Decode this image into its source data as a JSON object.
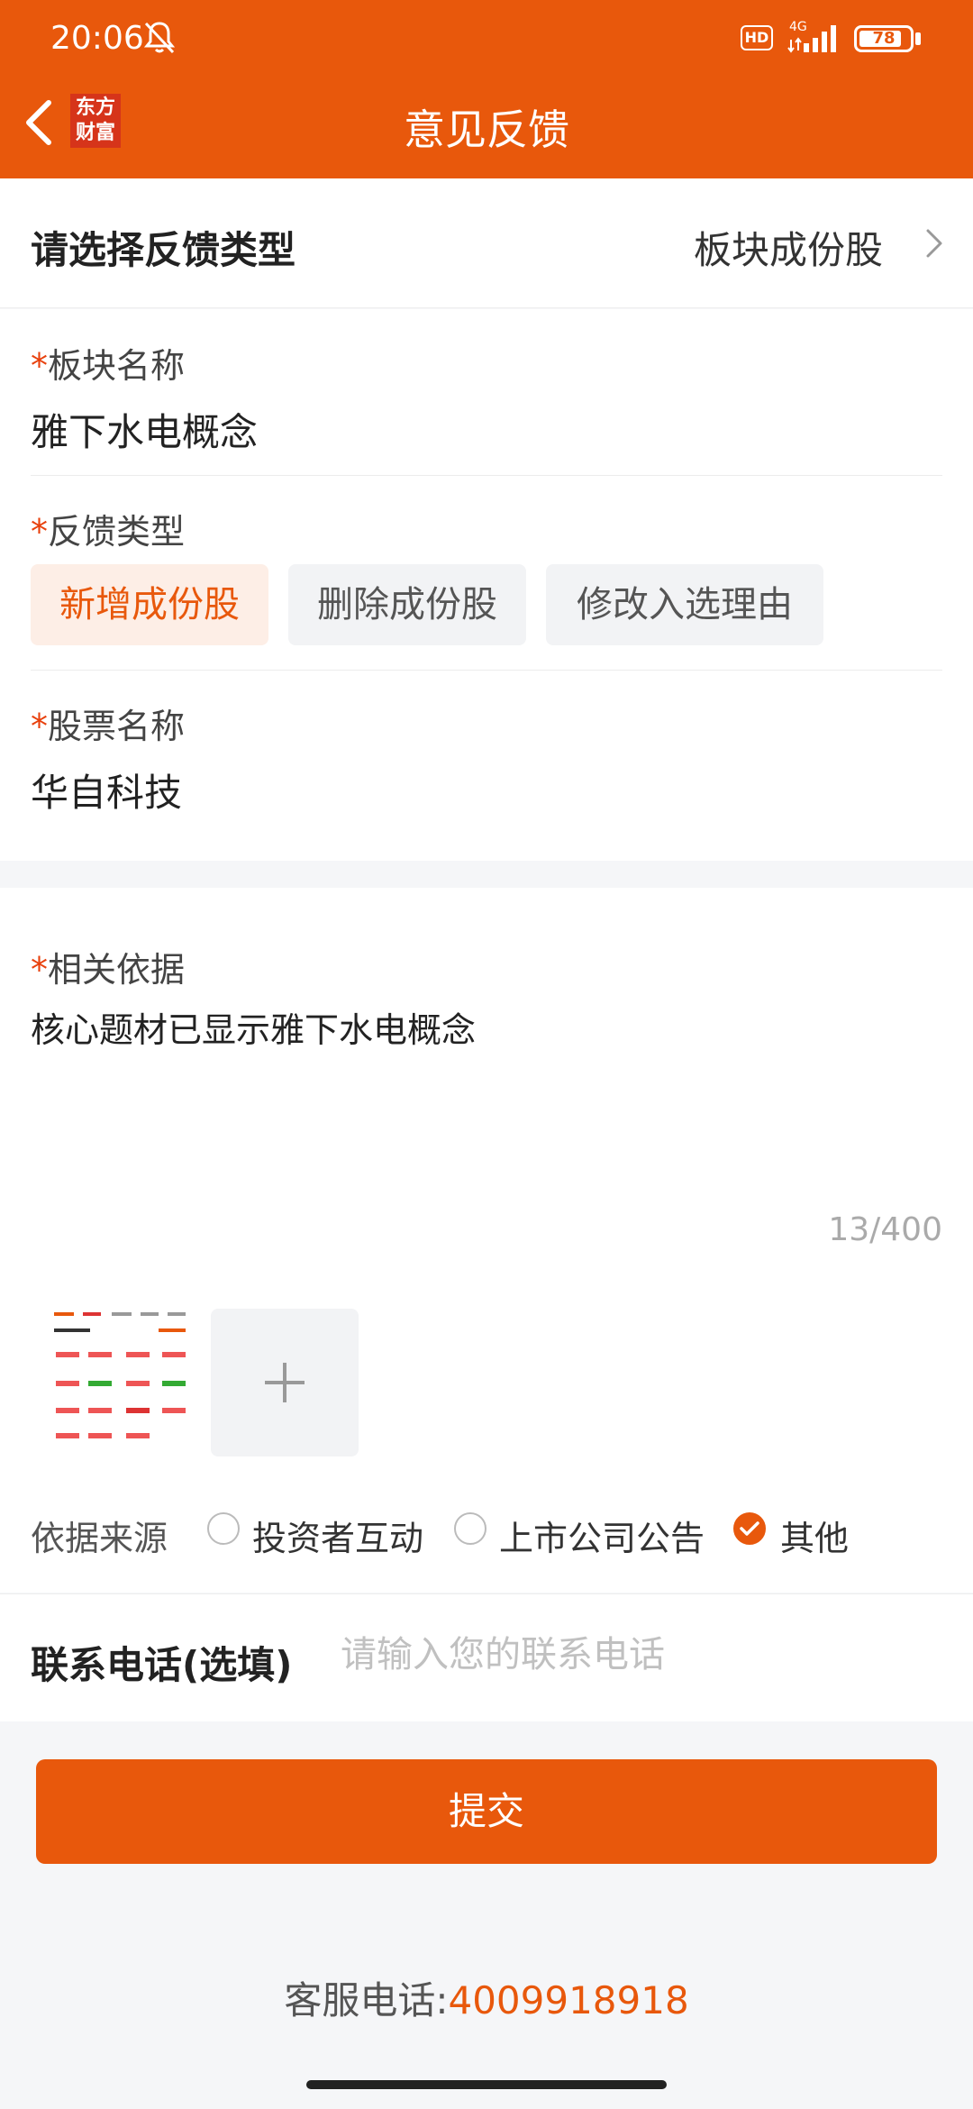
{
  "status_bar": {
    "time": "20:06",
    "hd": "HD",
    "network": "4G",
    "battery": "78"
  },
  "nav": {
    "logo_line1": "东方",
    "logo_line2": "财富",
    "title": "意见反馈"
  },
  "feedback_type_row": {
    "label": "请选择反馈类型",
    "value": "板块成份股"
  },
  "sector": {
    "label": "板块名称",
    "value": "雅下水电概念"
  },
  "feedback_kind": {
    "label": "反馈类型",
    "options": [
      "新增成份股",
      "删除成份股",
      "修改入选理由"
    ],
    "selected": "新增成份股"
  },
  "stock": {
    "label": "股票名称",
    "value": "华自科技"
  },
  "basis": {
    "label": "相关依据",
    "value": "核心题材已显示雅下水电概念",
    "counter": "13/400"
  },
  "source": {
    "label": "依据来源",
    "options": [
      "投资者互动",
      "上市公司公告",
      "其他"
    ],
    "selected": "其他"
  },
  "phone": {
    "label": "联系电话(选填)",
    "placeholder": "请输入您的联系电话"
  },
  "submit_label": "提交",
  "service": {
    "label": "客服电话:",
    "number": "4009918918"
  },
  "colors": {
    "brand": "#e8580c",
    "required_star": "#e8400c"
  },
  "required_mark": "*"
}
